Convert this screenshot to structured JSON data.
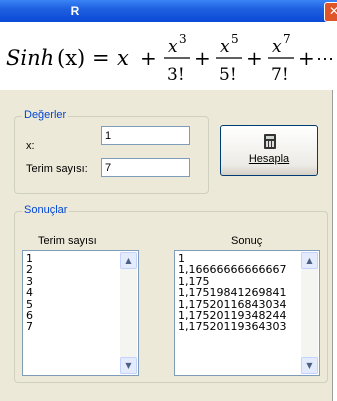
{
  "window": {
    "title": "R",
    "close_glyph": "✕"
  },
  "formula": {
    "func": "Sinh",
    "arg": "(x)",
    "eq": "=",
    "x": "x",
    "plus": "+",
    "terms": [
      {
        "num": "x",
        "exp": "3",
        "den": "3!"
      },
      {
        "num": "x",
        "exp": "5",
        "den": "5!"
      },
      {
        "num": "x",
        "exp": "7",
        "den": "7!"
      }
    ],
    "ellipsis": "⋯"
  },
  "inputs_group": {
    "legend": "Değerler",
    "x_label": "x:",
    "x_value": "1",
    "terms_label": "Terim sayısı:",
    "terms_value": "7"
  },
  "calculate_button": {
    "label": "Hesapla",
    "icon": "calculator-icon"
  },
  "results_group": {
    "legend": "Sonuçlar",
    "col_terms": "Terim sayısı",
    "col_result": "Sonuç",
    "terms": [
      "1",
      "2",
      "3",
      "4",
      "5",
      "6",
      "7"
    ],
    "results": [
      "1",
      "1,16666666666667",
      "1,175",
      "1,17519841269841",
      "1,17520116843034",
      "1,17520119348244",
      "1,17520119364303"
    ]
  },
  "scroll_glyphs": {
    "up": "▲",
    "down": "▼"
  },
  "colors": {
    "title_bar": "#0a49d6",
    "face": "#ece9d8",
    "group_legend": "#0046d5",
    "field_border": "#7f9db9",
    "close_button": "#e0542a"
  }
}
